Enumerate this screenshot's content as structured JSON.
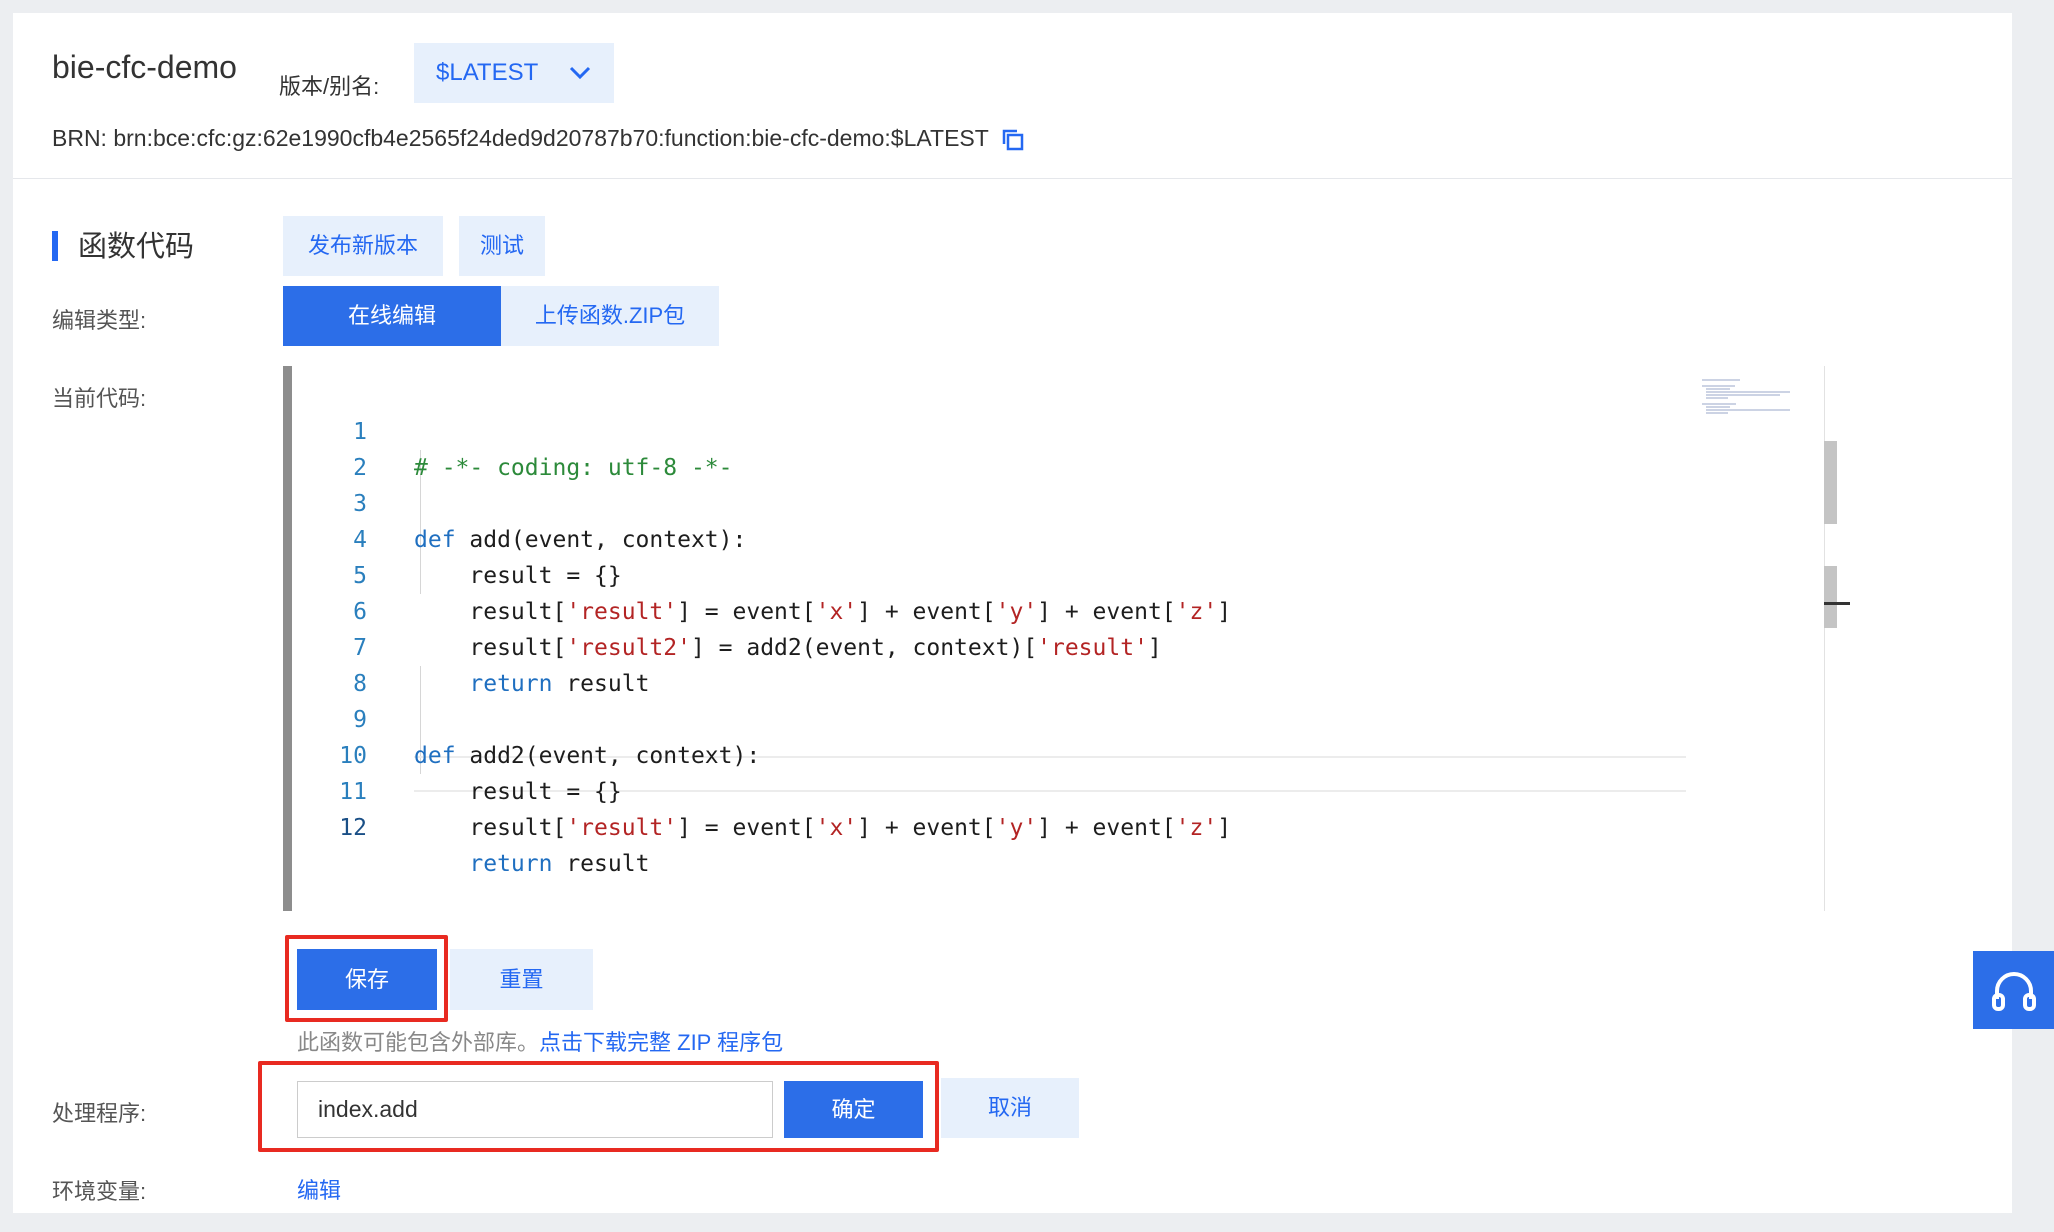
{
  "header": {
    "function_name": "bie-cfc-demo",
    "version_label": "版本/别名:",
    "version_value": "$LATEST",
    "brn_label": "BRN:",
    "brn_value": "brn:bce:cfc:gz:62e1990cfb4e2565f24ded9d20787b70:function:bie-cfc-demo:$LATEST"
  },
  "section": {
    "title": "函数代码",
    "publish_btn": "发布新版本",
    "test_btn": "测试"
  },
  "edit_type": {
    "label": "编辑类型:",
    "options": [
      "在线编辑",
      "上传函数.ZIP包"
    ],
    "active": "在线编辑"
  },
  "current_code": {
    "label": "当前代码:",
    "lines": [
      "# -*- coding: utf-8 -*-",
      "",
      "def add(event, context):",
      "    result = {}",
      "    result['result'] = event['x'] + event['y'] + event['z']",
      "    result['result2'] = add2(event, context)['result']",
      "    return result",
      "",
      "def add2(event, context):",
      "    result = {}",
      "    result['result'] = event['x'] + event['y'] + event['z']",
      "    return result"
    ],
    "line_numbers": [
      "1",
      "2",
      "3",
      "4",
      "5",
      "6",
      "7",
      "8",
      "9",
      "10",
      "11",
      "12"
    ]
  },
  "actions": {
    "save": "保存",
    "reset": "重置",
    "hint_text": "此函数可能包含外部库。",
    "hint_link": "点击下载完整 ZIP 程序包"
  },
  "handler": {
    "label": "处理程序:",
    "value": "index.add",
    "confirm": "确定",
    "cancel": "取消"
  },
  "env": {
    "label": "环境变量:",
    "edit_link": "编辑"
  },
  "colors": {
    "accent": "#2c6ee8",
    "highlight_box": "#e82a21",
    "light_button_bg": "#e7f0fc"
  },
  "icons": [
    "chevron-down-icon",
    "copy-icon",
    "headset-icon"
  ]
}
